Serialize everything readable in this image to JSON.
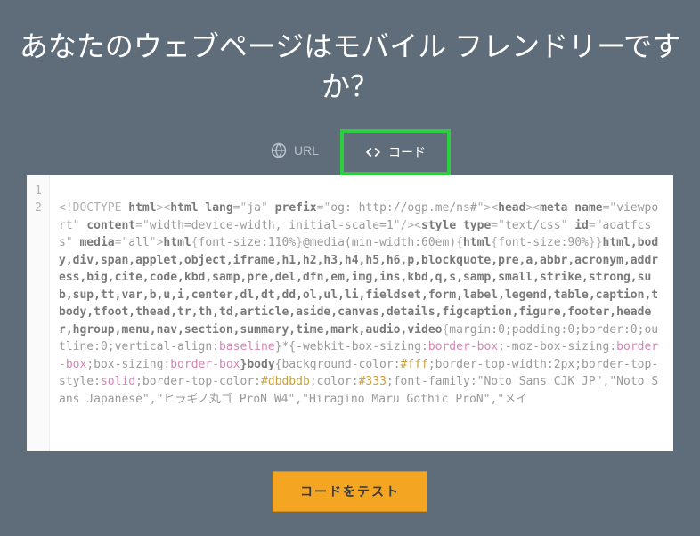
{
  "header": {
    "title": "あなたのウェブページはモバイル フレンドリーですか？"
  },
  "tabs": {
    "url_label": "URL",
    "code_label": "コード"
  },
  "editor": {
    "line1": "1",
    "line2": "2"
  },
  "code": {
    "doctype": "<!DOCTYPE ",
    "html_kw": "html",
    "close1": "><",
    "html_tag": "html ",
    "lang_attr": "lang",
    "eq": "=",
    "q": "\"",
    "ja": "ja",
    "sp": " ",
    "prefix_attr": "prefix",
    "prefix_val": "og: http://ogp.me/ns#",
    "close2": "><",
    "head_tag": "head",
    "close3": "><",
    "meta_tag": "meta ",
    "name_attr": "name",
    "viewport": "viewport",
    "content_attr": "content",
    "content_val": "width=device-width, initial-scale=1",
    "selfclose": "/><",
    "style_tag": "style ",
    "type_attr": "type",
    "textcss": "text/css",
    "id_attr": "id",
    "aoatfcss": "aoatfcss",
    "media_attr": "media",
    "all": "all",
    "gt": ">",
    "html_sel": "html",
    "ob": "{",
    "fontsize": "font-size:110%",
    "cb": "}",
    "atmedia": "@media(min-width:60em)",
    "html_sel2": "html",
    "fontsize2": "font-size:90%",
    "cb2": "}}",
    "sel_list": "html,body,div,span,applet,object,iframe,h1,h2,h3,h4,h5,h6,p,blockquote,pre,a,abbr,acronym,address,big,cite,code,kbd,samp,pre,del,dfn,em,img,ins,kbd,q,s,samp,small,strike,strong,sub,sup,tt,var,b,u,i,center,dl,dt,dd,ol,ul,li,fieldset,form,label,legend,table,caption,tbody,tfoot,thead,tr,th,td,article,aside,canvas,details,figcaption,figure,footer,header,hgroup,menu,nav,section,summary,time,mark,audio,video",
    "reset_rules": "margin:0;padding:0;border:0;outline:0;vertical-align:",
    "baseline": "baseline",
    "star": "}*{-webkit-box-sizing:",
    "borderbox": "border-box",
    "moz": ";-moz-box-sizing:",
    "box2": ";box-sizing:",
    "body_sel": "}body",
    "bodyrules1": "{background-color:",
    "fff": "#fff",
    "bodyrules2": ";border-top-width:2px;border-top-style:",
    "solid": "solid",
    "bodyrules3": ";border-top-color:",
    "dbdbdb": "#dbdbdb",
    "colorrule": ";color:",
    "c333": "#333",
    "fontfam": ";font-family:\"Noto Sans CJK JP\",\"Noto Sans Japanese\",\"ヒラギノ丸ゴ ProN W4\",\"Hiragino Maru Gothic ProN\",\"メイ"
  },
  "button": {
    "test_label": "コードをテスト"
  }
}
